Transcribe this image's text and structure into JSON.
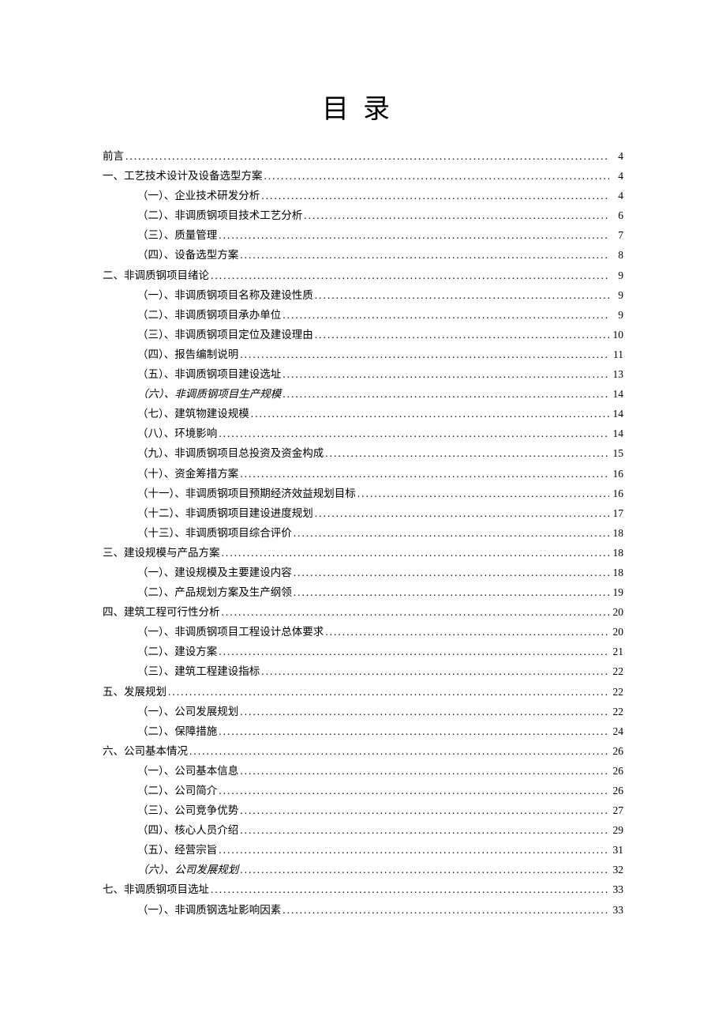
{
  "title": "目录",
  "entries": [
    {
      "level": 1,
      "label": "前言",
      "page": "4",
      "italic": false
    },
    {
      "level": 1,
      "label": "一、工艺技术设计及设备选型方案",
      "page": "4",
      "italic": false
    },
    {
      "level": 2,
      "label": "（一）、企业技术研发分析",
      "page": "4",
      "italic": false
    },
    {
      "level": 2,
      "label": "（二）、非调质钢项目技术工艺分析",
      "page": "6",
      "italic": false
    },
    {
      "level": 2,
      "label": "（三）、质量管理",
      "page": "7",
      "italic": false
    },
    {
      "level": 2,
      "label": "（四）、设备选型方案",
      "page": "8",
      "italic": false
    },
    {
      "level": 1,
      "label": "二、非调质钢项目绪论",
      "page": "9",
      "italic": false
    },
    {
      "level": 2,
      "label": "（一）、非调质钢项目名称及建设性质",
      "page": "9",
      "italic": false
    },
    {
      "level": 2,
      "label": "（二）、非调质钢项目承办单位",
      "page": "9",
      "italic": false
    },
    {
      "level": 2,
      "label": "（三）、非调质钢项目定位及建设理由",
      "page": "10",
      "italic": false
    },
    {
      "level": 2,
      "label": "（四）、报告编制说明",
      "page": "11",
      "italic": false
    },
    {
      "level": 2,
      "label": "（五）、非调质钢项目建设选址",
      "page": "13",
      "italic": false
    },
    {
      "level": 2,
      "label": "（六）、非调质钢项目生产规模",
      "page": "14",
      "italic": true
    },
    {
      "level": 2,
      "label": "（七）、建筑物建设规模",
      "page": "14",
      "italic": false
    },
    {
      "level": 2,
      "label": "（八）、环境影响",
      "page": "14",
      "italic": false
    },
    {
      "level": 2,
      "label": "（九）、非调质钢项目总投资及资金构成",
      "page": "15",
      "italic": false
    },
    {
      "level": 2,
      "label": "（十）、资金筹措方案",
      "page": "16",
      "italic": false
    },
    {
      "level": 2,
      "label": "（十一）、非调质钢项目预期经济效益规划目标",
      "page": "16",
      "italic": false
    },
    {
      "level": 2,
      "label": "（十二）、非调质钢项目建设进度规划",
      "page": "17",
      "italic": false
    },
    {
      "level": 2,
      "label": "（十三）、非调质钢项目综合评价",
      "page": "18",
      "italic": false
    },
    {
      "level": 1,
      "label": "三、建设规模与产品方案",
      "page": "18",
      "italic": false
    },
    {
      "level": 2,
      "label": "（一）、建设规模及主要建设内容",
      "page": "18",
      "italic": false
    },
    {
      "level": 2,
      "label": "（二）、产品规划方案及生产纲领",
      "page": "19",
      "italic": false
    },
    {
      "level": 1,
      "label": "四、建筑工程可行性分析",
      "page": "20",
      "italic": false
    },
    {
      "level": 2,
      "label": "（一）、非调质钢项目工程设计总体要求",
      "page": "20",
      "italic": false
    },
    {
      "level": 2,
      "label": "（二）、建设方案",
      "page": "21",
      "italic": false
    },
    {
      "level": 2,
      "label": "（三）、建筑工程建设指标",
      "page": "22",
      "italic": false
    },
    {
      "level": 1,
      "label": "五、发展规划",
      "page": "22",
      "italic": false
    },
    {
      "level": 2,
      "label": "（一）、公司发展规划",
      "page": "22",
      "italic": false
    },
    {
      "level": 2,
      "label": "（二）、保障措施",
      "page": "24",
      "italic": false
    },
    {
      "level": 1,
      "label": "六、公司基本情况",
      "page": "26",
      "italic": false
    },
    {
      "level": 2,
      "label": "（一）、公司基本信息",
      "page": "26",
      "italic": false
    },
    {
      "level": 2,
      "label": "（二）、公司简介",
      "page": "26",
      "italic": false
    },
    {
      "level": 2,
      "label": "（三）、公司竞争优势",
      "page": "27",
      "italic": false
    },
    {
      "level": 2,
      "label": "（四）、核心人员介绍",
      "page": "29",
      "italic": false
    },
    {
      "level": 2,
      "label": "（五）、经营宗旨",
      "page": "31",
      "italic": false
    },
    {
      "level": 2,
      "label": "（六）、公司发展规划",
      "page": "32",
      "italic": true
    },
    {
      "level": 1,
      "label": "七、非调质钢项目选址",
      "page": "33",
      "italic": false
    },
    {
      "level": 2,
      "label": "（一）、非调质钢选址影响因素",
      "page": "33",
      "italic": false
    }
  ]
}
